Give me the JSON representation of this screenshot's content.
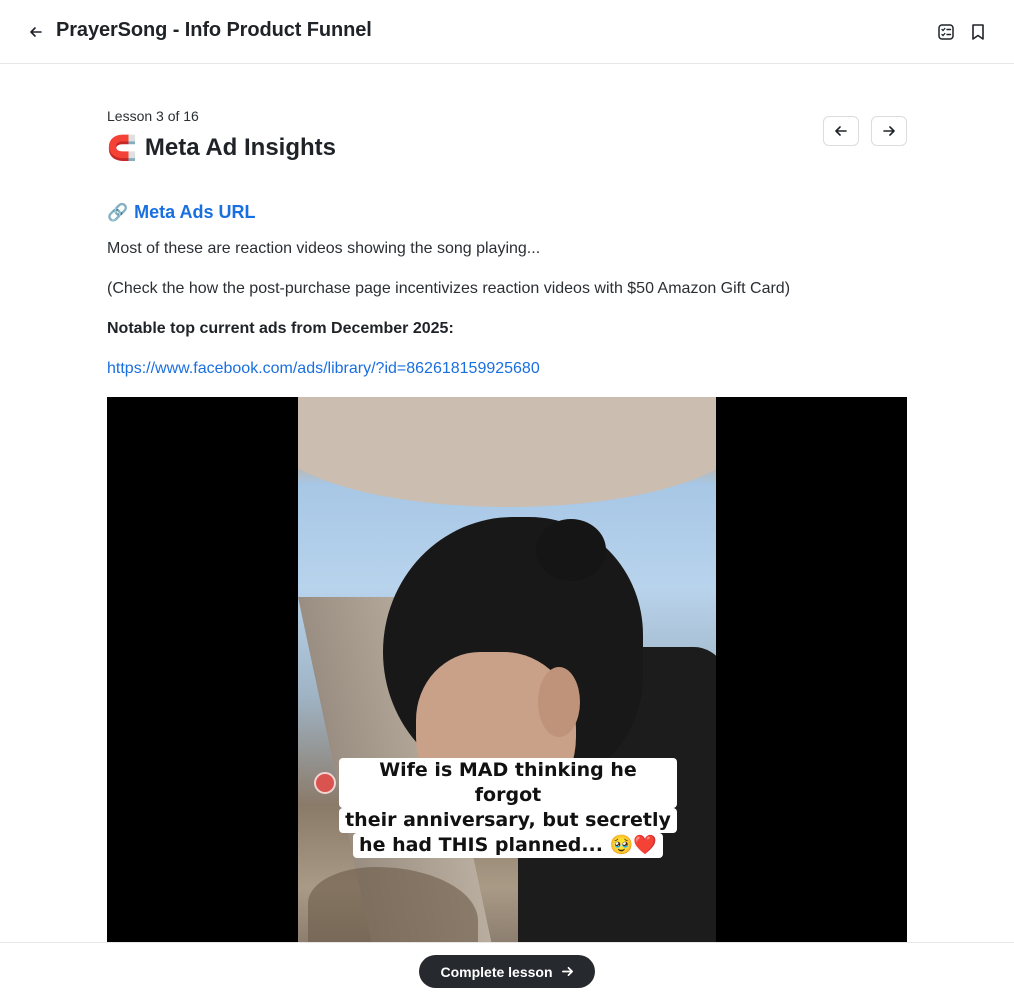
{
  "header": {
    "title": "PrayerSong - Info Product Funnel",
    "back_icon": "arrow-left-icon",
    "contents_icon": "list-checks-icon",
    "bookmark_icon": "bookmark-icon"
  },
  "lesson": {
    "meta": "Lesson 3 of 16",
    "emoji": "🧲",
    "title": "Meta Ad Insights",
    "prev_icon": "arrow-left-icon",
    "next_icon": "arrow-right-icon"
  },
  "content": {
    "link_emoji": "🔗",
    "link_heading": "Meta Ads URL",
    "paragraph_1": "Most of these are reaction videos showing the song playing...",
    "paragraph_2": "(Check the how the post-purchase page incentivizes reaction videos with $50 Amazon Gift Card)",
    "paragraph_3": "Notable top current ads from December 2025:",
    "ad_url": "https://www.facebook.com/ads/library/?id=862618159925680"
  },
  "video": {
    "caption_line_1": "Wife is MAD thinking he forgot",
    "caption_line_2": "their anniversary, but secretly",
    "caption_line_3": "he had THIS planned... 🥹❤️"
  },
  "footer": {
    "complete_label": "Complete lesson",
    "complete_icon": "arrow-right-icon"
  },
  "colors": {
    "link": "#1a6fe0",
    "button_dark": "#26292d"
  }
}
